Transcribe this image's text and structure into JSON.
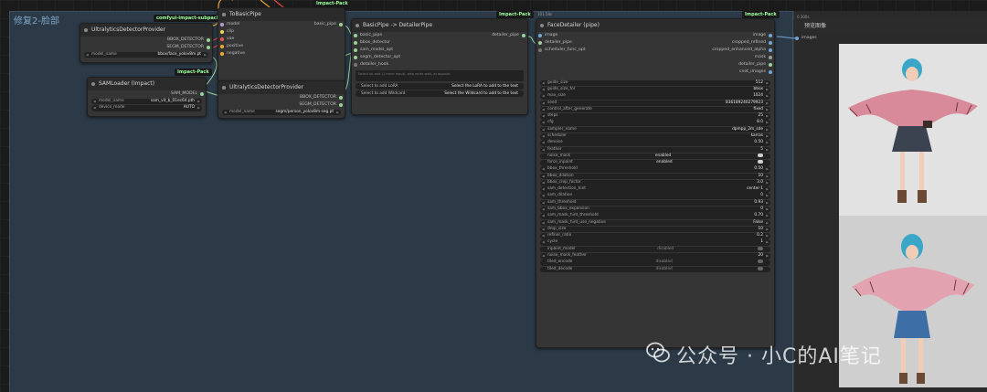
{
  "group": {
    "title": "修复2-脸部"
  },
  "tags": {
    "subpack": "comfyui-impact-subpack",
    "pack": "Impact-Pack"
  },
  "ultra1": {
    "title": "UltralyticsDetectorProvider",
    "outputs": [
      "BBOX_DETECTOR",
      "SEGM_DETECTOR"
    ],
    "widget_label": "model_name",
    "widget_value": "bbox/face_yolov8m.pt"
  },
  "sam": {
    "title": "SAMLoader (Impact)",
    "output": "SAM_MODEL",
    "widgets": [
      {
        "label": "model_name",
        "value": "sam_vit_b_01ec64.pth"
      },
      {
        "label": "device_mode",
        "value": "AUTO"
      }
    ]
  },
  "tobasic": {
    "title": "ToBasicPipe",
    "inputs": [
      "model",
      "clip",
      "vae",
      "positive",
      "negative"
    ],
    "output": "basic_pipe"
  },
  "ultra2": {
    "title": "UltralyticsDetectorProvider",
    "outputs": [
      "BBOX_DETECTOR",
      "SEGM_DETECTOR"
    ],
    "widget_label": "model_name",
    "widget_value": "segm/person_yolov8m-seg.pt"
  },
  "basicpipe": {
    "title": "BasicPipe -> DetailerPipe",
    "inputs": [
      "basic_pipe",
      "bbox_detector",
      "sam_model_opt",
      "segm_detector_opt",
      "detailer_hook"
    ],
    "output": "detailer_pipe",
    "textarea": "Select lol and (1 more input), who write wait, at appoint",
    "buttons": [
      {
        "label": "Select to add LoRA",
        "value": "Select the LoRA to add to the text"
      },
      {
        "label": "Select to add Wildcard",
        "value": "Select the Wildcard to add to the text"
      }
    ]
  },
  "face": {
    "title": "FaceDetailer (pipe)",
    "timing": "101.58s",
    "inputs": [
      "image",
      "detailer_pipe",
      "scheduler_func_opt"
    ],
    "outputs": [
      "image",
      "cropped_refined",
      "cropped_enhanced_alpha",
      "mask",
      "detailer_pipe",
      "cnet_images"
    ],
    "widgets": [
      {
        "label": "guide_size",
        "value": "512"
      },
      {
        "label": "guide_size_for",
        "value": "bbox"
      },
      {
        "label": "max_size",
        "value": "1024"
      },
      {
        "label": "seed",
        "value": "836189240279923"
      },
      {
        "label": "control_after_generate",
        "value": "fixed"
      },
      {
        "label": "steps",
        "value": "25"
      },
      {
        "label": "cfg",
        "value": "8.0"
      },
      {
        "label": "sampler_name",
        "value": "dpmpp_2m_sde"
      },
      {
        "label": "scheduler",
        "value": "karras"
      },
      {
        "label": "denoise",
        "value": "0.50"
      },
      {
        "label": "feather",
        "value": "5"
      },
      {
        "label": "noise_mask",
        "value": "enabled"
      },
      {
        "label": "force_inpaint",
        "value": "enabled"
      },
      {
        "label": "bbox_threshold",
        "value": "0.50"
      },
      {
        "label": "bbox_dilation",
        "value": "10"
      },
      {
        "label": "bbox_crop_factor",
        "value": "3.0"
      },
      {
        "label": "sam_detection_hint",
        "value": "center-1"
      },
      {
        "label": "sam_dilation",
        "value": "0"
      },
      {
        "label": "sam_threshold",
        "value": "0.93"
      },
      {
        "label": "sam_bbox_expansion",
        "value": "0"
      },
      {
        "label": "sam_mask_hint_threshold",
        "value": "0.70"
      },
      {
        "label": "sam_mask_hint_use_negative",
        "value": "False"
      },
      {
        "label": "drop_size",
        "value": "10"
      },
      {
        "label": "refiner_ratio",
        "value": "0.2"
      },
      {
        "label": "cycle",
        "value": "1"
      },
      {
        "label": "inpaint_model",
        "value": "disabled"
      },
      {
        "label": "noise_mask_feather",
        "value": "20"
      },
      {
        "label": "tiled_encode",
        "value": "disabled"
      },
      {
        "label": "tiled_decode",
        "value": "disabled"
      }
    ]
  },
  "preview": {
    "timing": "0.300s",
    "title": "预览图像",
    "input": "images"
  },
  "watermark": {
    "text": "公众号 · 小C的AI笔记"
  }
}
